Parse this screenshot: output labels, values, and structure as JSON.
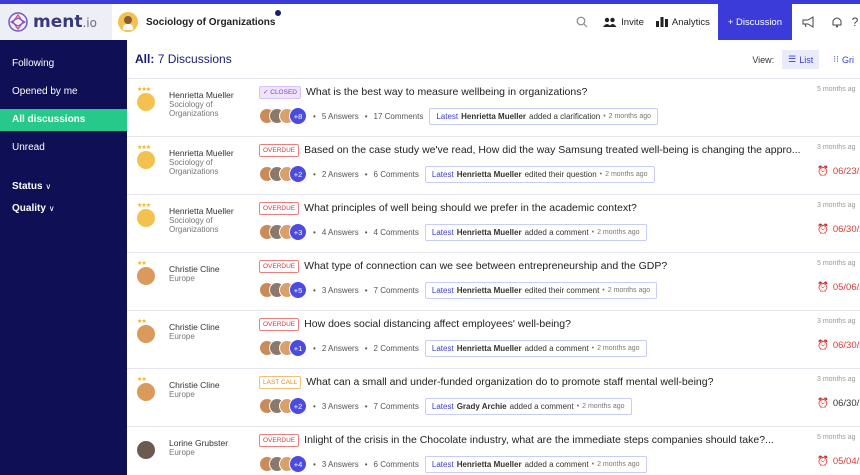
{
  "brand": {
    "name": "ment",
    "suffix": ".io"
  },
  "course": {
    "title": "Sociology of Organizations"
  },
  "top": {
    "invite": "Invite",
    "analytics": "Analytics",
    "discussion": "+ Discussion"
  },
  "sidebar": {
    "items": [
      {
        "label": "Following"
      },
      {
        "label": "Opened by me"
      },
      {
        "label": "All discussions"
      },
      {
        "label": "Unread"
      }
    ],
    "groups": [
      {
        "label": "Status"
      },
      {
        "label": "Quality"
      }
    ]
  },
  "main": {
    "title_prefix": "All:",
    "title_count": "7 Discussions",
    "view_label": "View:",
    "view_list": "List",
    "view_grid": "Gri"
  },
  "discussions": [
    {
      "author": "Henrietta Mueller",
      "sub": "Sociology of Organizations",
      "badge": "✓ CLOSED",
      "badge_type": "closed",
      "question": "What is the best way to measure wellbeing in organizations?",
      "more": "+8",
      "answers": "5 Answers",
      "comments": "17 Comments",
      "latest_label": "Latest",
      "latest_who": "Henrietta Mueller",
      "latest_action": "added a clarification",
      "latest_when": "2 months ago",
      "ago": "5 months ag",
      "due": ""
    },
    {
      "author": "Henrietta Mueller",
      "sub": "Sociology of Organizations",
      "badge": "OVERDUE",
      "badge_type": "overdue",
      "question": "Based on the case study we've read, How did the way Samsung treated well-being is changing the appro...",
      "more": "+2",
      "answers": "2 Answers",
      "comments": "6 Comments",
      "latest_label": "Latest",
      "latest_who": "Henrietta Mueller",
      "latest_action": "edited their question",
      "latest_when": "2 months ago",
      "ago": "3 months ag",
      "due": "06/23/2"
    },
    {
      "author": "Henrietta Mueller",
      "sub": "Sociology of Organizations",
      "badge": "OVERDUE",
      "badge_type": "overdue",
      "question": "What principles of well being should we prefer in the academic context?",
      "more": "+3",
      "answers": "4 Answers",
      "comments": "4 Comments",
      "latest_label": "Latest",
      "latest_who": "Henrietta Mueller",
      "latest_action": "added a comment",
      "latest_when": "2 months ago",
      "ago": "3 months ag",
      "due": "06/30/2"
    },
    {
      "author": "Christie Cline",
      "sub": "Europe",
      "badge": "OVERDUE",
      "badge_type": "overdue",
      "question": "What type of connection can we see between entrepreneurship and the GDP?",
      "more": "+5",
      "answers": "3 Answers",
      "comments": "7 Comments",
      "latest_label": "Latest",
      "latest_who": "Henrietta Mueller",
      "latest_action": "edited their comment",
      "latest_when": "2 months ago",
      "ago": "5 months ag",
      "due": "05/06/2"
    },
    {
      "author": "Christie Cline",
      "sub": "Europe",
      "badge": "OVERDUE",
      "badge_type": "overdue",
      "question": "How does social distancing affect employees' well-being?",
      "more": "+1",
      "answers": "2 Answers",
      "comments": "2 Comments",
      "latest_label": "Latest",
      "latest_who": "Henrietta Mueller",
      "latest_action": "added a comment",
      "latest_when": "2 months ago",
      "ago": "3 months ag",
      "due": "06/30/2"
    },
    {
      "author": "Christie Cline",
      "sub": "Europe",
      "badge": "LAST CALL",
      "badge_type": "lastcall",
      "question": "What can a small and under-funded organization do to promote staff mental well-being?",
      "more": "+2",
      "answers": "3 Answers",
      "comments": "7 Comments",
      "latest_label": "Latest",
      "latest_who": "Grady Archie",
      "latest_action": "added a comment",
      "latest_when": "2 months ago",
      "ago": "3 months ag",
      "due": "06/30/"
    },
    {
      "author": "Lorine Grubster",
      "sub": "Europe",
      "badge": "OVERDUE",
      "badge_type": "overdue",
      "question": "Inlight of the crisis in the Chocolate industry, what are the immediate steps companies should take?...",
      "more": "+4",
      "answers": "3 Answers",
      "comments": "6 Comments",
      "latest_label": "Latest",
      "latest_who": "Henrietta Mueller",
      "latest_action": "added a comment",
      "latest_when": "2 months ago",
      "ago": "5 months ag",
      "due": "05/04/2"
    }
  ],
  "colors": {
    "accent": "#3b3bd9",
    "sidebar": "#0f0f55",
    "active": "#27c98a",
    "overdue": "#d53a3a"
  }
}
